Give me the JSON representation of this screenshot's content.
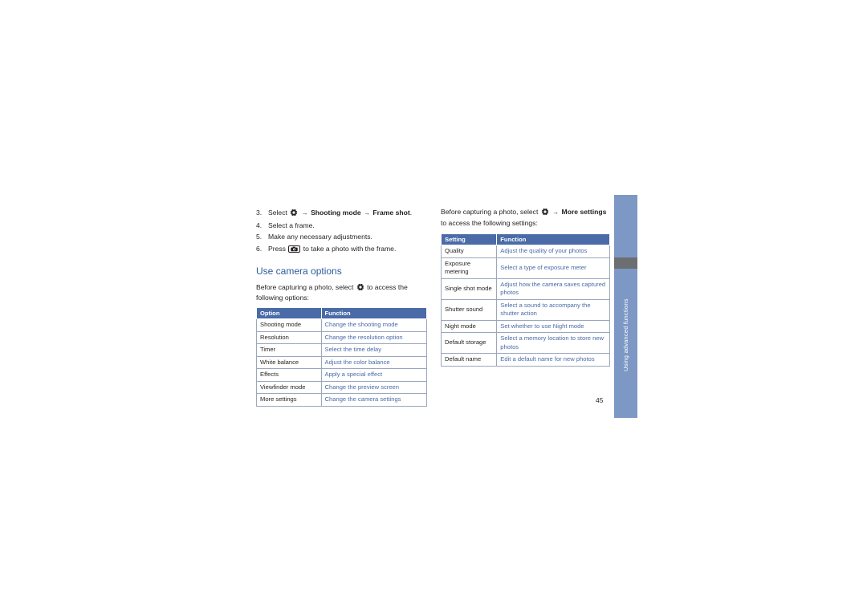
{
  "page": {
    "number": "45",
    "side_tab_text": "Using advanced functions"
  },
  "left_column": {
    "steps": [
      {
        "num": "3.",
        "text_before": "Select",
        "icon": "gear-icon",
        "arrow1": "→",
        "bold1": "Shooting mode",
        "arrow2": "→",
        "bold2": "Frame shot",
        "text_after": "."
      },
      {
        "num": "4.",
        "text": "Select a frame."
      },
      {
        "num": "5.",
        "text": "Make any necessary adjustments."
      },
      {
        "num": "6.",
        "text_before": "Press",
        "icon": "camera-key-icon",
        "text_after": "to take a photo with the frame."
      }
    ],
    "section_title": "Use camera options",
    "intro_before": "Before capturing a photo, select",
    "intro_icon": "gear-icon",
    "intro_after": "to access the",
    "intro_line2": "following options:",
    "table": {
      "headers": [
        "Option",
        "Function"
      ],
      "rows": [
        [
          "Shooting mode",
          "Change the shooting mode"
        ],
        [
          "Resolution",
          "Change the resolution option"
        ],
        [
          "Timer",
          "Select the time delay"
        ],
        [
          "White balance",
          "Adjust the color balance"
        ],
        [
          "Effects",
          "Apply a special effect"
        ],
        [
          "Viewfinder mode",
          "Change the preview screen"
        ],
        [
          "More settings",
          "Change the camera settings"
        ]
      ]
    }
  },
  "right_column": {
    "intro_before": "Before capturing a photo, select",
    "intro_icon": "gear-icon",
    "intro_arrow": "→",
    "intro_bold": "More",
    "intro_bold2": "settings",
    "intro_after": "to access the following settings:",
    "table": {
      "headers": [
        "Setting",
        "Function"
      ],
      "rows": [
        [
          "Quality",
          "Adjust the quality of your photos"
        ],
        [
          "Exposure metering",
          "Select a type of exposure meter"
        ],
        [
          "Single shot mode",
          "Adjust how the camera saves captured photos"
        ],
        [
          "Shutter sound",
          "Select a sound to accompany the shutter action"
        ],
        [
          "Night mode",
          "Set whether to use Night mode"
        ],
        [
          "Default storage",
          "Select a memory location to store new photos"
        ],
        [
          "Default name",
          "Edit a default name for new photos"
        ]
      ]
    }
  },
  "colors": {
    "accent_blue": "#4a6ba8",
    "heading_blue": "#2e5a9c",
    "side_tab": "#7d98c4",
    "notch_gray": "#6d6e71"
  }
}
